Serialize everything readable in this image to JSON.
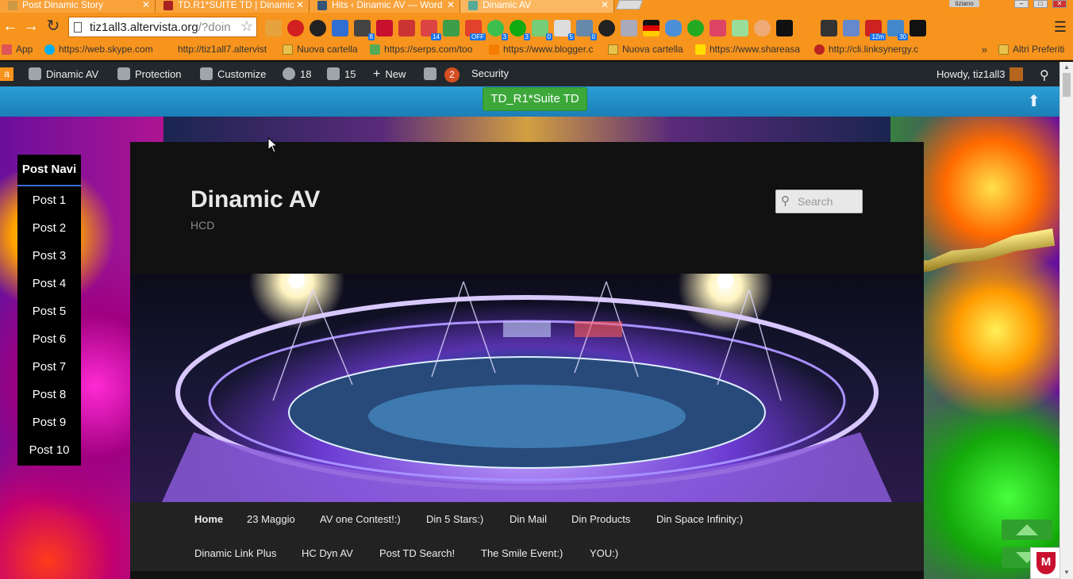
{
  "browser": {
    "tabs": [
      {
        "title": "Post Dinamic Story",
        "active": false
      },
      {
        "title": "TD.R1*SUITE TD | Dinamic",
        "active": false
      },
      {
        "title": "Hits ‹ Dinamic AV — Word",
        "active": false
      },
      {
        "title": "Dinamic AV",
        "active": true
      }
    ],
    "profile_name": "tiziano",
    "url": "tiz1all3.altervista.org",
    "url_rest": "/?doin",
    "extension_badges": [
      "8",
      "14",
      "OFF",
      "3",
      "3",
      "0",
      "5",
      "0",
      "12m",
      "30"
    ],
    "bookmarks": [
      {
        "label": "App",
        "folder": false
      },
      {
        "label": "https://web.skype.com",
        "folder": false
      },
      {
        "label": "http://tiz1all7.altervist",
        "folder": false
      },
      {
        "label": "Nuova cartella",
        "folder": true
      },
      {
        "label": "https://serps.com/too",
        "folder": false
      },
      {
        "label": "https://www.blogger.c",
        "folder": false
      },
      {
        "label": "Nuova cartella",
        "folder": true
      },
      {
        "label": "https://www.shareasa",
        "folder": false
      },
      {
        "label": "http://cli.linksynergy.c",
        "folder": false
      }
    ],
    "bookmarks_more": "»",
    "other_bookmarks": "Altri Preferiti"
  },
  "adminbar": {
    "site": "Dinamic AV",
    "protection": "Protection",
    "customize": "Customize",
    "updates": "18",
    "comments": "15",
    "new": "New",
    "seo_badge": "2",
    "security": "Security",
    "howdy": "Howdy, tiz1all3"
  },
  "site": {
    "suite_button": "TD_R1*Suite TD",
    "title": "Dinamic AV",
    "description": "HCD",
    "search_placeholder": "Search",
    "post_nav": {
      "heading": "Post Navi",
      "items": [
        "Post 1",
        "Post 2",
        "Post 3",
        "Post 4",
        "Post 5",
        "Post 6",
        "Post 7",
        "Post 8",
        "Post 9",
        "Post 10"
      ]
    },
    "menu": [
      "Home",
      "23 Maggio",
      "AV one Contest!:)",
      "Din 5 Stars:)",
      "Din Mail",
      "Din Products",
      "Din Space Infinity:)",
      "Dinamic Link Plus",
      "HC Dyn AV",
      "Post TD Search!",
      "The Smile Event:)",
      "YOU:)"
    ]
  },
  "colors": {
    "browser_orange": "#f7941d",
    "adminbar": "#23282d",
    "blue_bar": "#2a9fd6",
    "suite_green": "#3ca83a",
    "page_dark": "#111111"
  }
}
